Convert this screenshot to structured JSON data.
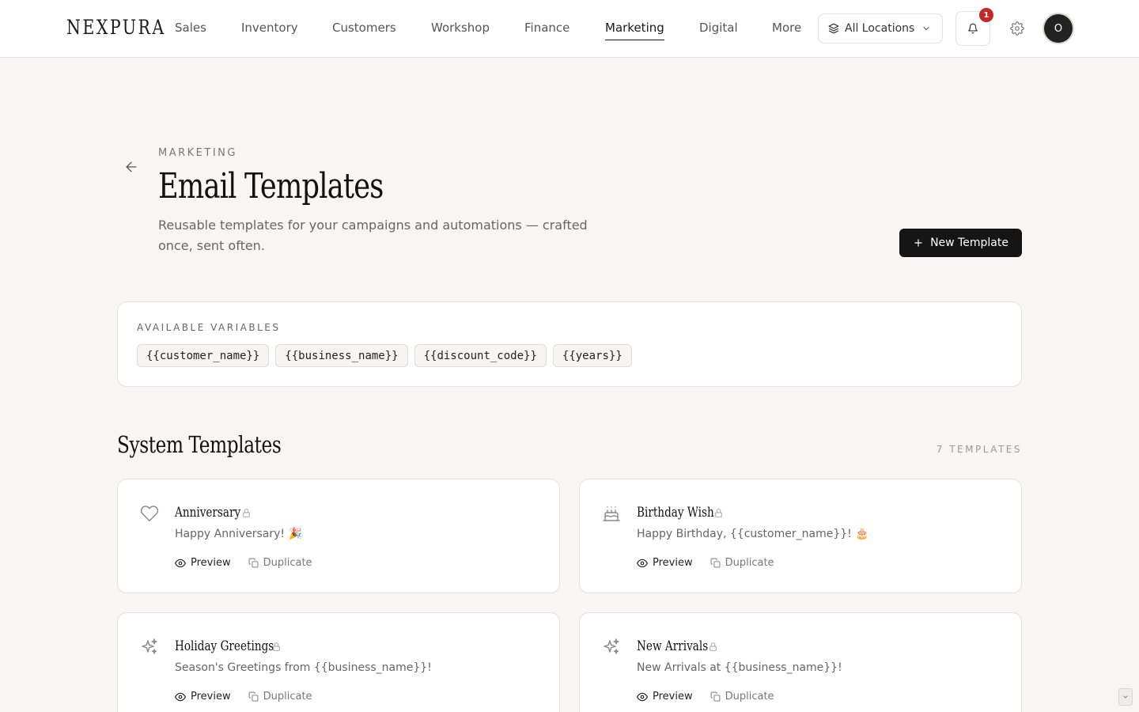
{
  "brand": {
    "name": "NEXPURA"
  },
  "nav": {
    "items": [
      {
        "label": "Sales",
        "active": false
      },
      {
        "label": "Inventory",
        "active": false
      },
      {
        "label": "Customers",
        "active": false
      },
      {
        "label": "Workshop",
        "active": false
      },
      {
        "label": "Finance",
        "active": false
      },
      {
        "label": "Marketing",
        "active": true
      },
      {
        "label": "Digital",
        "active": false
      },
      {
        "label": "More",
        "active": false
      }
    ],
    "location_selector": {
      "label": "All Locations",
      "icon": "layers-icon"
    },
    "notifications": {
      "count": "1",
      "icon": "bell-icon"
    },
    "settings": {
      "icon": "gear-icon"
    },
    "user": {
      "initial": "O"
    }
  },
  "header": {
    "eyebrow": "MARKETING",
    "title": "Email Templates",
    "subtitle": "Reusable templates for your campaigns and automations — crafted once, sent often.",
    "new_button_label": "New Template"
  },
  "variables": {
    "label": "AVAILABLE VARIABLES",
    "items": [
      "{{customer_name}}",
      "{{business_name}}",
      "{{discount_code}}",
      "{{years}}"
    ]
  },
  "system_templates": {
    "title": "System Templates",
    "count": "7 TEMPLATES",
    "cards": [
      {
        "name": "Anniversary",
        "subject": "Happy Anniversary! 🎉",
        "icon": "heart-icon",
        "preview_label": "Preview",
        "duplicate_label": "Duplicate"
      },
      {
        "name": "Birthday Wish",
        "subject": "Happy Birthday, {{customer_name}}! 🎂",
        "icon": "cake-icon",
        "preview_label": "Preview",
        "duplicate_label": "Duplicate"
      },
      {
        "name": "Holiday Greetings",
        "subject": "Season's Greetings from {{business_name}}!",
        "icon": "sparkles-icon",
        "preview_label": "Preview",
        "duplicate_label": "Duplicate"
      },
      {
        "name": "New Arrivals",
        "subject": "New Arrivals at {{business_name}}!",
        "icon": "sparkles-icon",
        "preview_label": "Preview",
        "duplicate_label": "Duplicate"
      }
    ]
  },
  "colors": {
    "background": "#f7f6f4",
    "primary_button": "#151515",
    "notification_badge": "#c62828"
  }
}
